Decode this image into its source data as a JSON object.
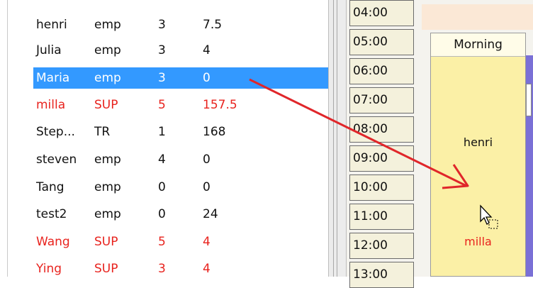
{
  "employees": [
    {
      "name": "henri",
      "role": "emp",
      "level": "3",
      "hours": "7.5"
    },
    {
      "name": "Julia",
      "role": "emp",
      "level": "3",
      "hours": "4"
    },
    {
      "name": "Maria",
      "role": "emp",
      "level": "3",
      "hours": "0"
    },
    {
      "name": "milla",
      "role": "SUP",
      "level": "5",
      "hours": "157.5"
    },
    {
      "name": "Step...",
      "role": "TR",
      "level": "1",
      "hours": "168"
    },
    {
      "name": "steven",
      "role": "emp",
      "level": "4",
      "hours": "0"
    },
    {
      "name": "Tang",
      "role": "emp",
      "level": "0",
      "hours": "0"
    },
    {
      "name": "test2",
      "role": "emp",
      "level": "0",
      "hours": "24"
    },
    {
      "name": "Wang",
      "role": "SUP",
      "level": "5",
      "hours": "4"
    },
    {
      "name": "Ying",
      "role": "SUP",
      "level": "3",
      "hours": "4"
    }
  ],
  "times": [
    "04:00",
    "05:00",
    "06:00",
    "07:00",
    "08:00",
    "09:00",
    "10:00",
    "11:00",
    "12:00",
    "13:00"
  ],
  "schedule": {
    "column_title": "Morning",
    "shift1": "henri",
    "shift2": "milla"
  },
  "colors": {
    "selection": "#3399ff",
    "supervisor_text": "#e8231e",
    "morning_fill": "#fbf0a6",
    "arrow": "#e0262a"
  }
}
